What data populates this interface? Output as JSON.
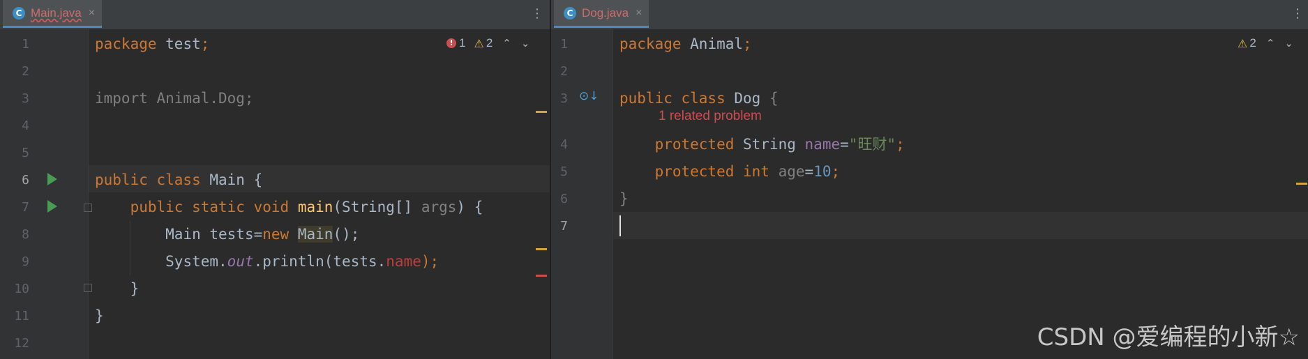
{
  "left_editor": {
    "tab": {
      "icon": "java-class-icon",
      "icon_glyph": "C",
      "name": "Main.java",
      "close": "×"
    },
    "menu_glyph": "⋮",
    "inspections": {
      "errors": "1",
      "warnings": "2",
      "up": "⌃",
      "down": "⌄",
      "error_glyph": "!",
      "warn_glyph": "⚠"
    },
    "line_numbers": [
      "1",
      "2",
      "3",
      "4",
      "5",
      "6",
      "7",
      "8",
      "9",
      "10",
      "11",
      "12"
    ],
    "code": {
      "l1_kw": "package",
      "l1_name": " test",
      "l1_semi": ";",
      "l3": "import Animal.Dog;",
      "l6_kw": "public class",
      "l6_name": " Main ",
      "l6_brace": "{",
      "l7_indent": "    ",
      "l7_kw": "public static void",
      "l7_sp": " ",
      "l7_fn": "main",
      "l7_paren": "(",
      "l7_type": "String",
      "l7_br": "[]",
      "l7_arg": " args",
      "l7_close": ") {",
      "l8_indent": "        ",
      "l8_type": "Main",
      "l8_var": " tests",
      "l8_eq": "=",
      "l8_new": "new",
      "l8_sp": " ",
      "l8_cls": "Main",
      "l8_end": "();",
      "l9_indent": "        ",
      "l9_sys": "System",
      "l9_dot1": ".",
      "l9_out": "out",
      "l9_dot2": ".println(",
      "l9_var": "tests",
      "l9_dot3": ".",
      "l9_err": "name",
      "l9_end": ");",
      "l10": "    }",
      "l11": "}"
    }
  },
  "right_editor": {
    "tab": {
      "icon": "java-class-icon",
      "icon_glyph": "C",
      "name": "Dog.java",
      "close": "×"
    },
    "menu_glyph": "⋮",
    "inspections": {
      "warnings": "2",
      "up": "⌃",
      "down": "⌄",
      "warn_glyph": "⚠"
    },
    "line_numbers": [
      "1",
      "2",
      "3",
      "4",
      "5",
      "6",
      "7"
    ],
    "related_problem": "1 related problem",
    "code": {
      "l1_kw": "package",
      "l1_name": " Animal",
      "l1_semi": ";",
      "l3_kw": "public class",
      "l3_name": " Dog ",
      "l3_brace": "{",
      "l4_indent": "    ",
      "l4_kw": "protected",
      "l4_type": " String ",
      "l4_fld": "name",
      "l4_eq": "=",
      "l4_str": "\"旺财\"",
      "l4_semi": ";",
      "l5_indent": "    ",
      "l5_kw": "protected",
      "l5_sp": " ",
      "l5_type": "int",
      "l5_fld": " age",
      "l5_eq": "=",
      "l5_num": "10",
      "l5_semi": ";",
      "l6": "}"
    }
  },
  "watermark": "CSDN @爱编程的小新☆"
}
